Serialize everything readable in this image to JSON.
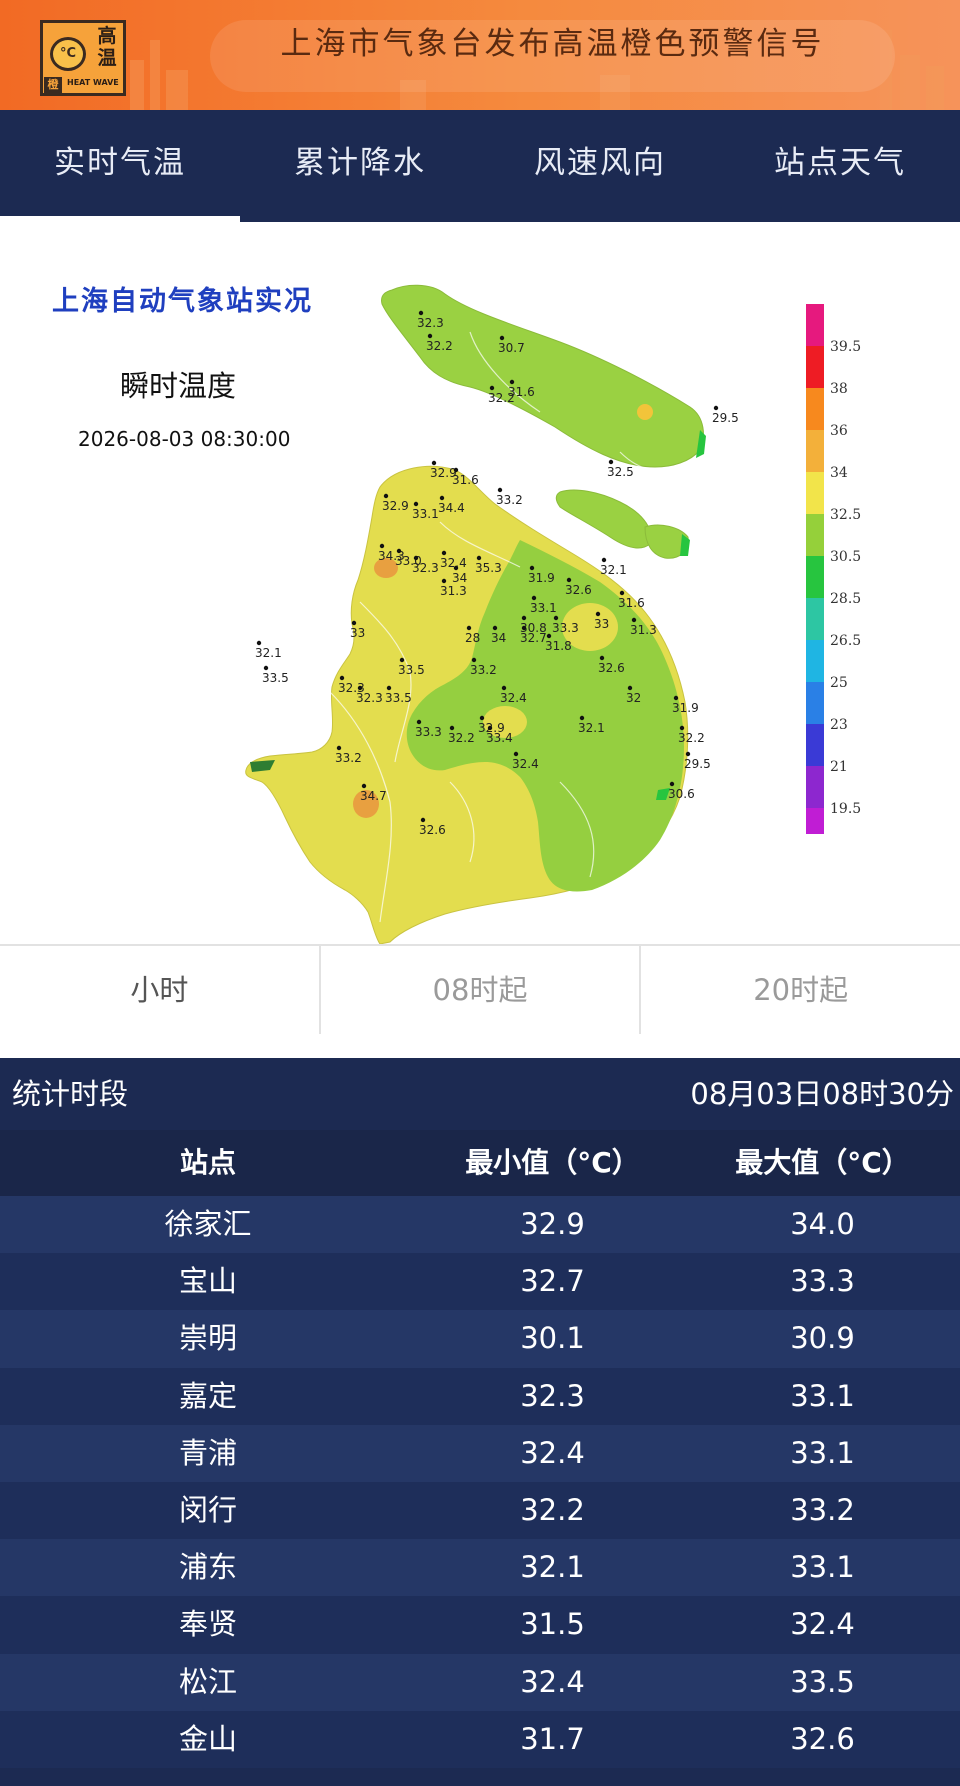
{
  "banner": {
    "icon_unit": "°C",
    "icon_chars": [
      "高",
      "温"
    ],
    "icon_level": "橙",
    "icon_caption": "HEAT WAVE",
    "title": "上海市气象台发布高温橙色预警信号"
  },
  "tabs": [
    {
      "label": "实时气温",
      "active": true
    },
    {
      "label": "累计降水",
      "active": false
    },
    {
      "label": "风速风向",
      "active": false
    },
    {
      "label": "站点天气",
      "active": false
    }
  ],
  "map": {
    "heading": "上海自动气象站实况",
    "subtitle": "瞬时温度",
    "datetime": "2026-08-03 08:30:00",
    "stations": [
      "32.3",
      "32.2",
      "30.7",
      "32.2",
      "31.6",
      "29.5",
      "32.5",
      "32.9",
      "31.6",
      "33.2",
      "32.9",
      "34.4",
      "33.1",
      "34.3",
      "33.0",
      "32.3",
      "32.4",
      "31.3",
      "34",
      "35.3",
      "31.9",
      "32.1",
      "32.6",
      "33.1",
      "30.8",
      "33.3",
      "33",
      "31.6",
      "31.3",
      "33",
      "32.1",
      "33.5",
      "32.3",
      "28",
      "34",
      "32.7",
      "31.8",
      "32.6",
      "33.2",
      "33.5",
      "32.3",
      "33.5",
      "32.4",
      "32",
      "31.9",
      "32.2",
      "32.9",
      "33.3",
      "32.2",
      "33.4",
      "32.1",
      "33.2",
      "32.4",
      "29.5",
      "34.7",
      "30.6",
      "32.6"
    ],
    "legend": [
      "39.5",
      "38",
      "36",
      "34",
      "32.5",
      "30.5",
      "28.5",
      "26.5",
      "25",
      "23",
      "21",
      "19.5"
    ],
    "legend_colors": [
      "#e6197e",
      "#ee1c24",
      "#f7891e",
      "#f3b03a",
      "#f2e44a",
      "#95d03a",
      "#27c53f",
      "#2dc6a3",
      "#1fb5e3",
      "#2a80e6",
      "#3a3ad6",
      "#8d27cf",
      "#c01dd4"
    ]
  },
  "periods": [
    {
      "label": "小时",
      "active": true
    },
    {
      "label": "08时起",
      "active": false
    },
    {
      "label": "20时起",
      "active": false
    }
  ],
  "stats": {
    "label": "统计时段",
    "time": "08月03日08时30分",
    "headers": [
      "站点",
      "最小值（°C）",
      "最大值（°C）"
    ],
    "rows": [
      [
        "徐家汇",
        "32.9",
        "34.0"
      ],
      [
        "宝山",
        "32.7",
        "33.3"
      ],
      [
        "崇明",
        "30.1",
        "30.9"
      ],
      [
        "嘉定",
        "32.3",
        "33.1"
      ],
      [
        "青浦",
        "32.4",
        "33.1"
      ],
      [
        "闵行",
        "32.2",
        "33.2"
      ],
      [
        "浦东",
        "32.1",
        "33.1"
      ],
      [
        "奉贤",
        "31.5",
        "32.4"
      ],
      [
        "松江",
        "32.4",
        "33.5"
      ],
      [
        "金山",
        "31.7",
        "32.6"
      ]
    ]
  }
}
